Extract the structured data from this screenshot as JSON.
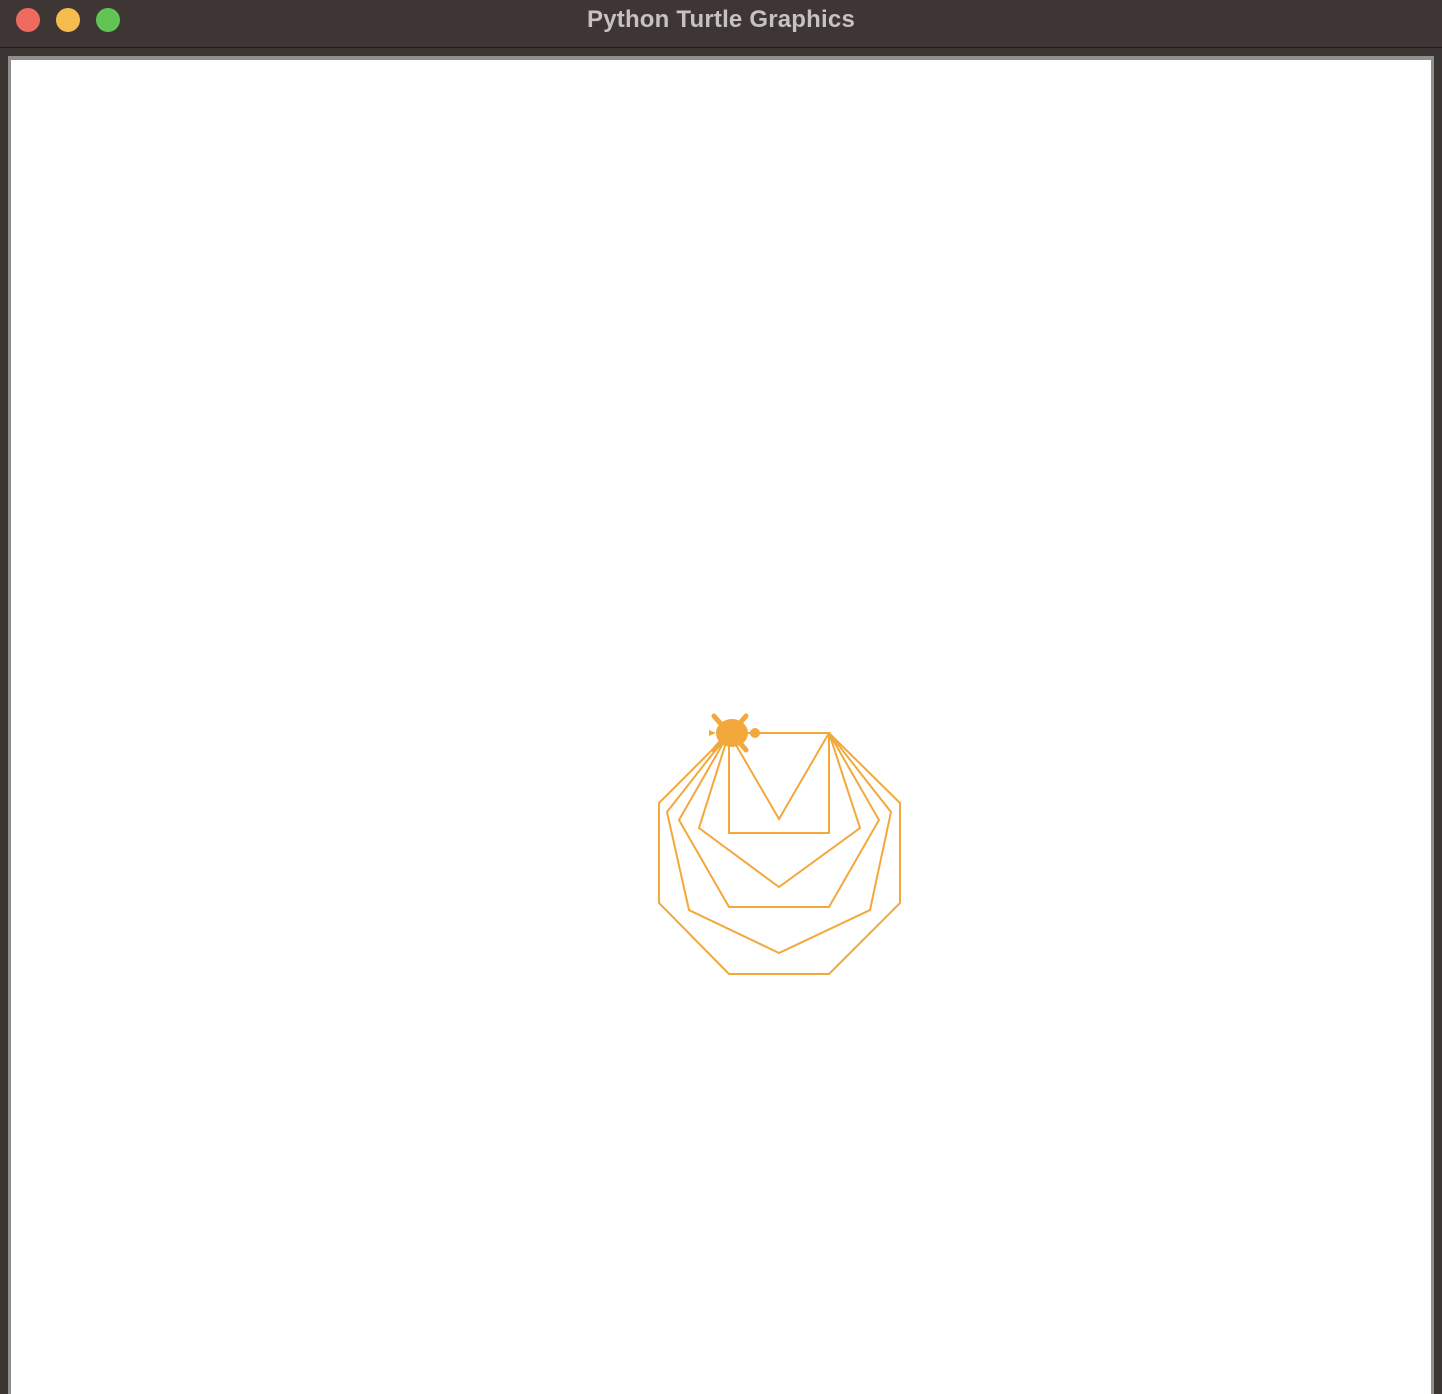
{
  "window": {
    "title": "Python Turtle Graphics"
  },
  "controls": {
    "close_color": "#ee6a5f",
    "minimize_color": "#f5bd4f",
    "zoom_color": "#61c554"
  },
  "canvas": {
    "background": "#ffffff",
    "pen_color": "#f2a83b",
    "turtle_color": "#f2a83b",
    "turtle_shape": "turtle-icon"
  }
}
